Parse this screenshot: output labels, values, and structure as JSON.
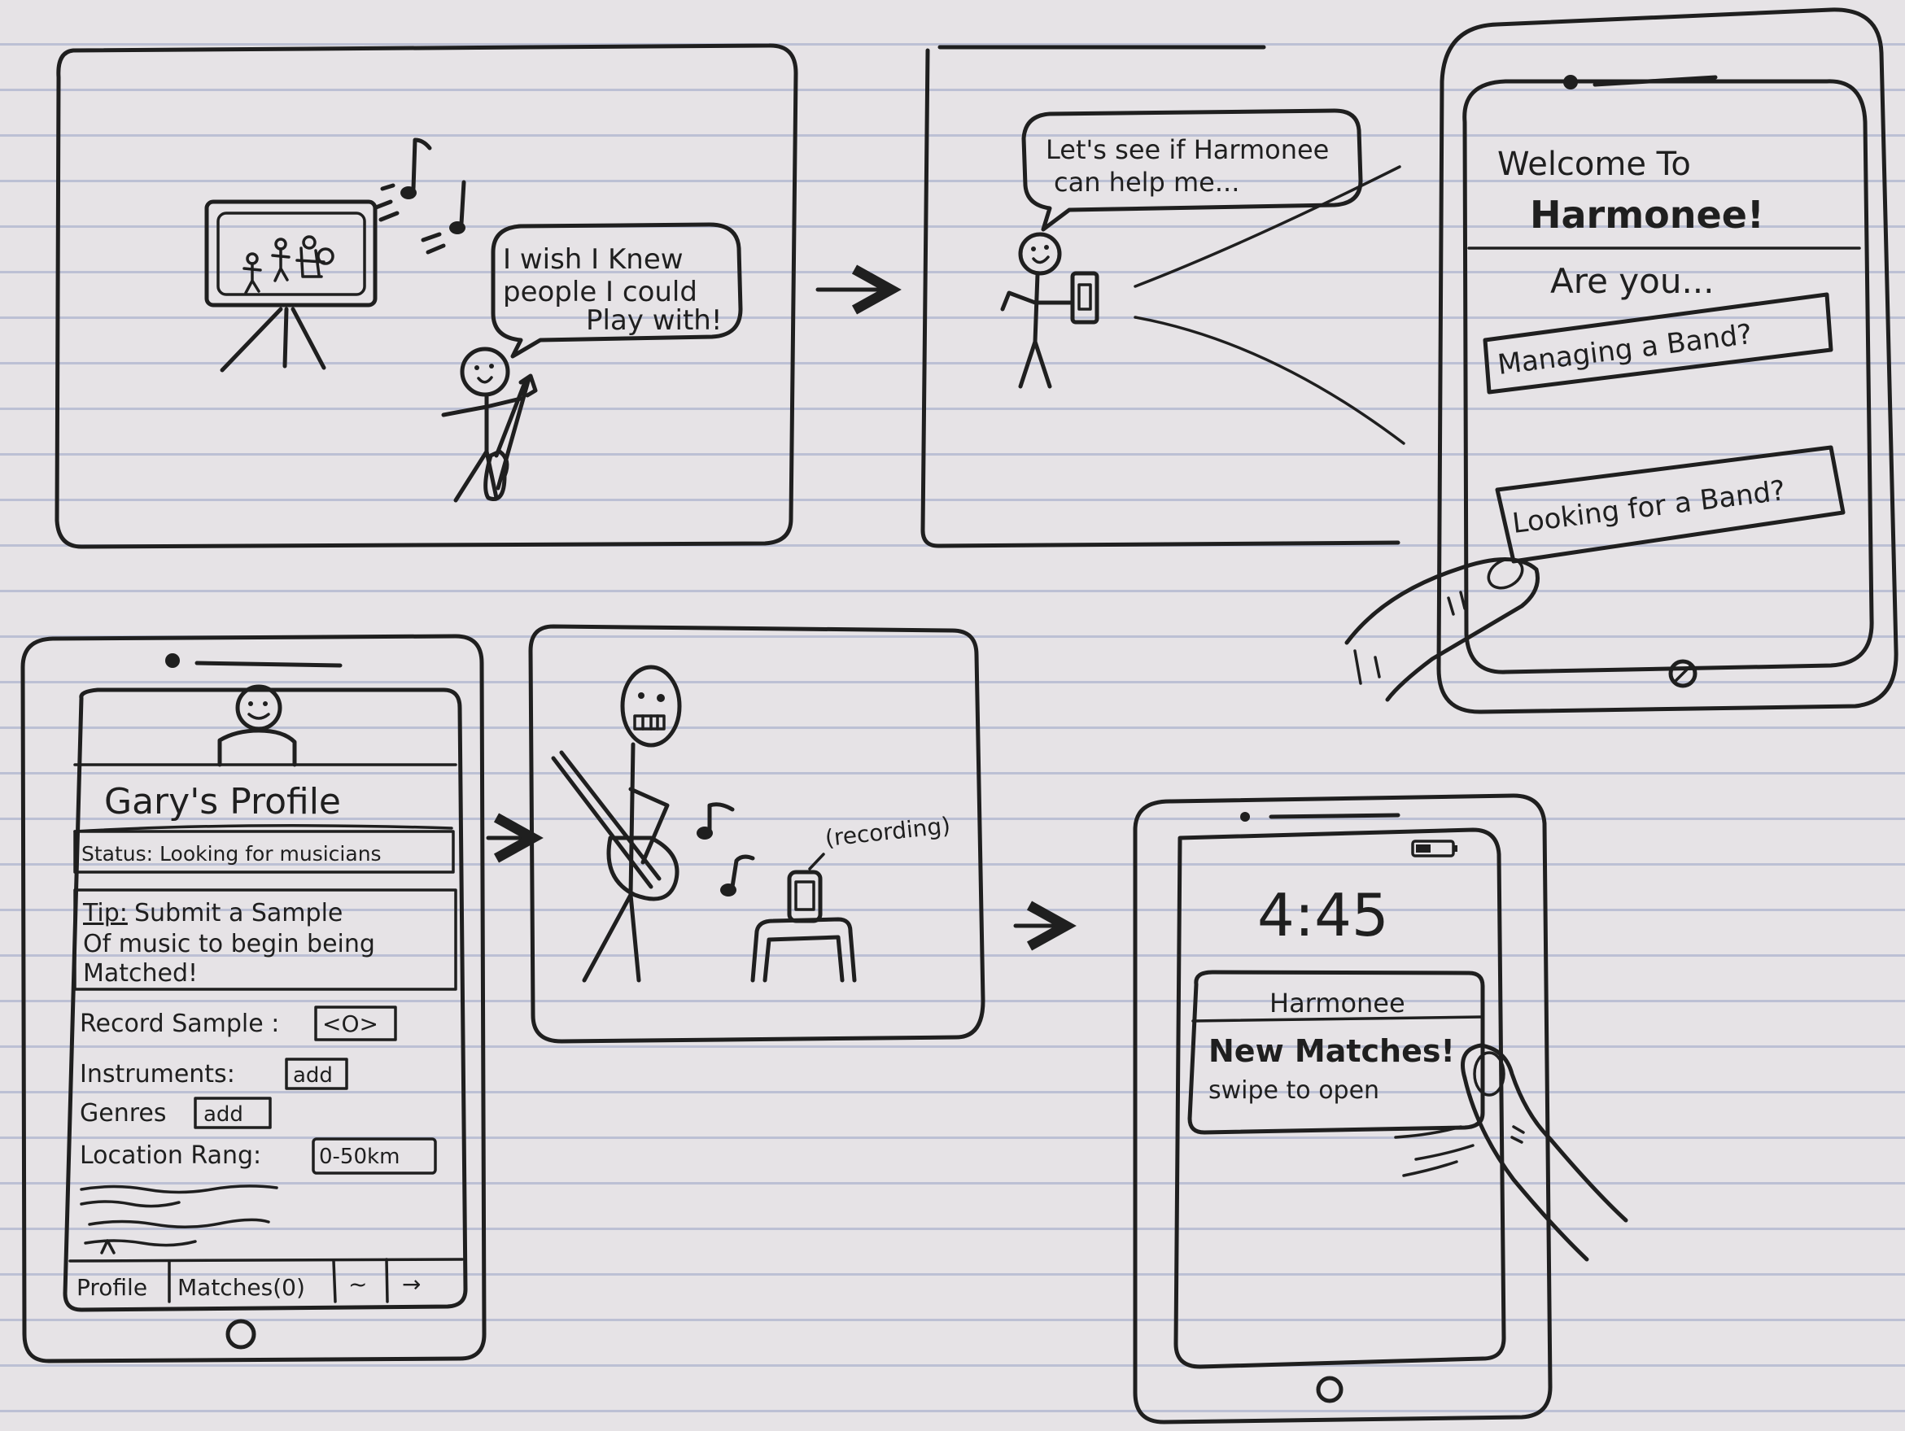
{
  "panel1": {
    "bubble": [
      "I wish I Knew",
      "people I could",
      "Play with!"
    ]
  },
  "panel2": {
    "bubble": [
      "Let's see if Harmonee",
      "can help me..."
    ]
  },
  "panel3": {
    "welcome": [
      "Welcome To",
      "Harmonee!"
    ],
    "prompt": "Are you...",
    "option_band": "Managing a Band?",
    "option_looking": "Looking for a Band?"
  },
  "panel4": {
    "title": "Gary's Profile",
    "status": "Status: Looking for musicians",
    "tip_label": "Tip:",
    "tip_lines": [
      "Submit a Sample",
      "Of music to begin being",
      "Matched!"
    ],
    "record_label": "Record Sample :",
    "record_button": "<O>",
    "instruments_label": "Instruments:",
    "instruments_button": "add",
    "genres_label": "Genres",
    "genres_button": "add",
    "location_label": "Location Rang:",
    "location_value": "0-50km",
    "tab_profile": "Profile",
    "tab_matches": "Matches(0)",
    "tab_more": "~",
    "tab_next": "→"
  },
  "panel5": {
    "annotation": "(recording)"
  },
  "panel6": {
    "time": "4:45",
    "app_name": "Harmonee",
    "message": "New Matches!",
    "hint": "swipe to open"
  }
}
